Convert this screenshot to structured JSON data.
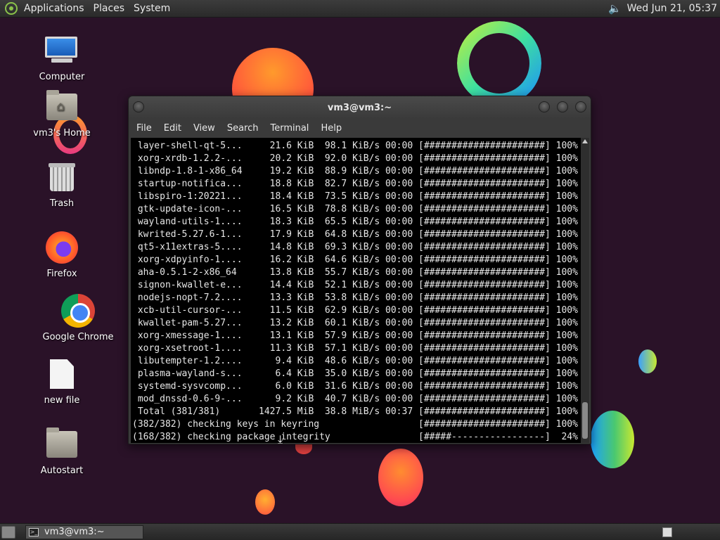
{
  "top_panel": {
    "menus": [
      "Applications",
      "Places",
      "System"
    ],
    "clock": "Wed Jun 21, 05:37"
  },
  "desktop_icons": {
    "computer": "Computer",
    "home": "vm3's Home",
    "trash": "Trash",
    "firefox": "Firefox",
    "chrome": "Google Chrome",
    "new_file": "new file",
    "autostart": "Autostart"
  },
  "window": {
    "title": "vm3@vm3:~",
    "menu": [
      "File",
      "Edit",
      "View",
      "Search",
      "Terminal",
      "Help"
    ]
  },
  "terminal_lines": [
    " layer-shell-qt-5...     21.6 KiB  98.1 KiB/s 00:00 [######################] 100%",
    " xorg-xrdb-1.2.2-...     20.2 KiB  92.0 KiB/s 00:00 [######################] 100%",
    " libndp-1.8-1-x86_64     19.2 KiB  88.9 KiB/s 00:00 [######################] 100%",
    " startup-notifica...     18.8 KiB  82.7 KiB/s 00:00 [######################] 100%",
    " libspiro-1:20221...     18.4 KiB  73.5 KiB/s 00:00 [######################] 100%",
    " gtk-update-icon-...     16.5 KiB  78.8 KiB/s 00:00 [######################] 100%",
    " wayland-utils-1....     18.3 KiB  65.5 KiB/s 00:00 [######################] 100%",
    " kwrited-5.27.6-1...     17.9 KiB  64.8 KiB/s 00:00 [######################] 100%",
    " qt5-x11extras-5....     14.8 KiB  69.3 KiB/s 00:00 [######################] 100%",
    " xorg-xdpyinfo-1....     16.2 KiB  64.6 KiB/s 00:00 [######################] 100%",
    " aha-0.5.1-2-x86_64      13.8 KiB  55.7 KiB/s 00:00 [######################] 100%",
    " signon-kwallet-e...     14.4 KiB  52.1 KiB/s 00:00 [######################] 100%",
    " nodejs-nopt-7.2....     13.3 KiB  53.8 KiB/s 00:00 [######################] 100%",
    " xcb-util-cursor-...     11.5 KiB  62.9 KiB/s 00:00 [######################] 100%",
    " kwallet-pam-5.27...     13.2 KiB  60.1 KiB/s 00:00 [######################] 100%",
    " xorg-xmessage-1....     13.1 KiB  57.9 KiB/s 00:00 [######################] 100%",
    " xorg-xsetroot-1....     11.3 KiB  57.1 KiB/s 00:00 [######################] 100%",
    " libutempter-1.2....      9.4 KiB  48.6 KiB/s 00:00 [######################] 100%",
    " plasma-wayland-s...      6.4 KiB  35.0 KiB/s 00:00 [######################] 100%",
    " systemd-sysvcomp...      6.0 KiB  31.6 KiB/s 00:00 [######################] 100%",
    " mod_dnssd-0.6-9-...      9.2 KiB  40.7 KiB/s 00:00 [######################] 100%",
    " Total (381/381)       1427.5 MiB  38.8 MiB/s 00:37 [######################] 100%",
    "(382/382) checking keys in keyring                  [######################] 100%",
    "(168/382) checking package integrity                [#####-----------------]  24%"
  ],
  "taskbar": {
    "task_label": "vm3@vm3:~",
    "task_icon": ">_"
  }
}
